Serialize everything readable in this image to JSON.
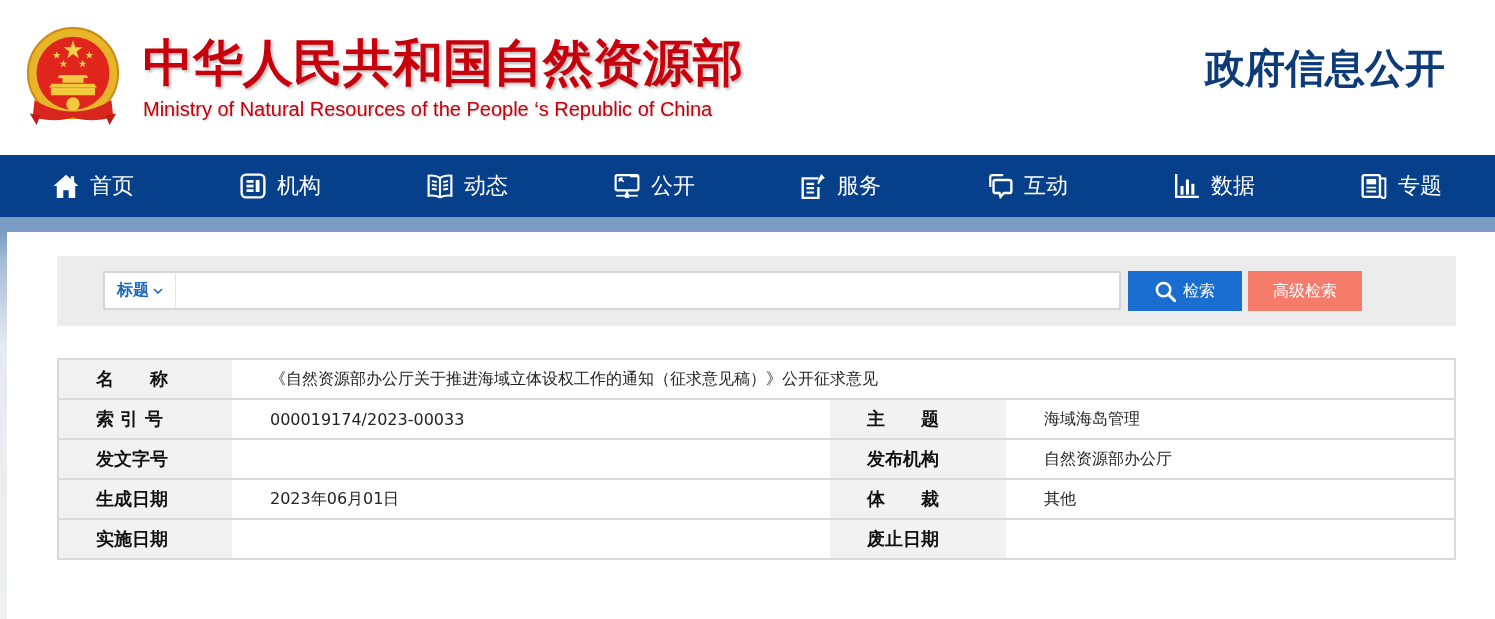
{
  "header": {
    "title": "中华人民共和国自然资源部",
    "subtitle": "Ministry of Natural Resources of the People ‘s Republic of China",
    "section": "政府信息公开"
  },
  "nav": [
    {
      "label": "首页"
    },
    {
      "label": "机构"
    },
    {
      "label": "动态"
    },
    {
      "label": "公开"
    },
    {
      "label": "服务"
    },
    {
      "label": "互动"
    },
    {
      "label": "数据"
    },
    {
      "label": "专题"
    }
  ],
  "search": {
    "scope": "标题",
    "buttons": [
      {
        "label": "检索",
        "kind": "primary"
      },
      {
        "label": "高级检索",
        "kind": "secondary"
      }
    ]
  },
  "record": {
    "rows": [
      {
        "fields": [
          {
            "label": "名　　称",
            "value": "《自然资源部办公厅关于推进海域立体设权工作的通知（征求意见稿）》公开征求意见"
          }
        ]
      },
      {
        "fields": [
          {
            "label": "索 引 号",
            "value": "000019174/2023-00033"
          },
          {
            "label": "主　　题",
            "value": "海域海岛管理"
          }
        ]
      },
      {
        "fields": [
          {
            "label": "发文字号"
          },
          {
            "label": "发布机构",
            "value": "自然资源部办公厅"
          }
        ]
      },
      {
        "fields": [
          {
            "label": "生成日期",
            "value": "2023年06月01日"
          },
          {
            "label": "体　　裁",
            "value": "其他"
          }
        ]
      },
      {
        "fields": [
          {
            "label": "实施日期"
          },
          {
            "label": "废止日期"
          }
        ]
      }
    ]
  }
}
